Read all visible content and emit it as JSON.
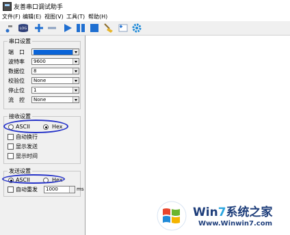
{
  "window": {
    "title": "友善串口调试助手"
  },
  "menu": [
    "文件(F)",
    "编辑(E)",
    "视图(V)",
    "工具(T)",
    "帮助(H)"
  ],
  "toolbar": {
    "icons": [
      "connect-icon",
      "log-icon",
      "add-icon",
      "remove-icon",
      "play-icon",
      "pause-icon",
      "stop-icon",
      "clear-icon",
      "insert-icon",
      "settings-icon"
    ],
    "log_label": "LOG"
  },
  "serial": {
    "title": "串口设置",
    "port_label": "端　口",
    "port_value": "",
    "baud_label": "波特率",
    "baud_value": "9600",
    "databits_label": "数据位",
    "databits_value": "8",
    "parity_label": "校验位",
    "parity_value": "None",
    "stopbits_label": "停止位",
    "stopbits_value": "1",
    "flow_label": "流　控",
    "flow_value": "None"
  },
  "receive": {
    "title": "接收设置",
    "ascii_label": "ASCII",
    "hex_label": "Hex",
    "selected": "Hex",
    "auto_wrap_label": "自动换行",
    "show_send_label": "显示发送",
    "show_time_label": "显示时间"
  },
  "send": {
    "title": "发送设置",
    "ascii_label": "ASCII",
    "hex_label": "Hex",
    "selected": "ASCII",
    "auto_resend_label": "自动重发",
    "interval_value": "1000",
    "interval_unit": "ms"
  },
  "watermark": {
    "brand_prefix": "Win",
    "brand_num": "7",
    "brand_suffix": "系统之家",
    "url": "Www.Winwin7.com"
  },
  "colors": {
    "highlight": "#0a64d8",
    "annotation": "#2633c8",
    "play": "#1f6fd1"
  }
}
